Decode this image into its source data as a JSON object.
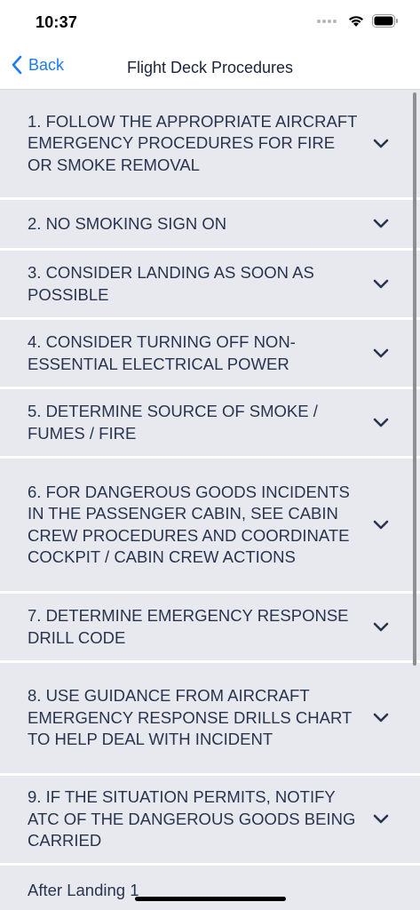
{
  "status_bar": {
    "time": "10:37"
  },
  "nav": {
    "back_label": "Back",
    "title": "Flight Deck Procedures"
  },
  "steps": [
    "1. FOLLOW THE APPROPRIATE AIRCRAFT EMERGENCY PROCEDURES FOR FIRE OR SMOKE REMOVAL",
    "2. NO SMOKING SIGN ON",
    "3. CONSIDER LANDING AS SOON AS POSSIBLE",
    "4. CONSIDER TURNING OFF NON-ESSENTIAL ELECTRICAL POWER",
    "5. DETERMINE SOURCE OF SMOKE / FUMES / FIRE",
    "6. FOR DANGEROUS GOODS INCIDENTS IN THE PASSENGER CABIN, SEE CABIN CREW PROCEDURES AND COORDINATE COCKPIT / CABIN CREW ACTIONS",
    "7. DETERMINE EMERGENCY RESPONSE DRILL CODE",
    "8. USE GUIDANCE FROM AIRCRAFT EMERGENCY RESPONSE DRILLS CHART TO HELP DEAL WITH INCIDENT",
    "9. IF THE  SITUATION  PERMITS, NOTIFY ATC  OF THE  DANGEROUS GOODS BEING CARRIED"
  ],
  "after_landing_label": "After Landing 1",
  "colors": {
    "accent": "#1a7cf5",
    "row_background": "#e8e9ee",
    "row_text": "#29344e"
  }
}
